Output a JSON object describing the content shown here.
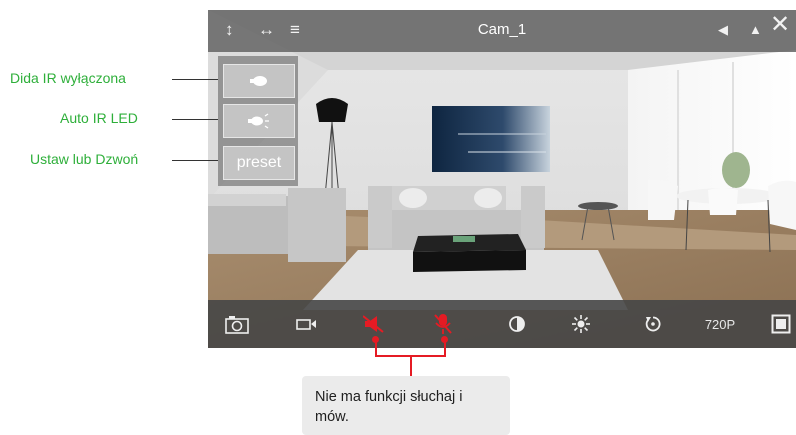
{
  "camera": {
    "title": "Cam_1",
    "top_icons_left": [
      "vertical-flip-icon",
      "horizontal-flip-icon",
      "menu-list-icon"
    ],
    "top_icons_right": [
      "arrow-left-icon",
      "arrow-up-icon",
      "close-icon"
    ]
  },
  "side_panel": {
    "buttons": [
      {
        "icon": "ir-off-icon"
      },
      {
        "icon": "auto-ir-led-icon"
      },
      {
        "label": "preset"
      }
    ]
  },
  "bottom_bar": {
    "icons": [
      "camera-snapshot-icon",
      "video-record-icon",
      "speaker-muted-icon",
      "microphone-muted-icon",
      "contrast-icon",
      "brightness-icon",
      "rotate-icon",
      "resolution-label",
      "fullscreen-icon"
    ],
    "resolution": "720P"
  },
  "annotations": {
    "ir_off": "Dida IR wyłączona",
    "auto_ir": "Auto IR LED",
    "preset": "Ustaw lub Dzwoń",
    "note": "Nie ma funkcji słuchaj i mów."
  },
  "colors": {
    "annotation_text": "#2eaf3a",
    "muted_red": "#e51b24"
  }
}
